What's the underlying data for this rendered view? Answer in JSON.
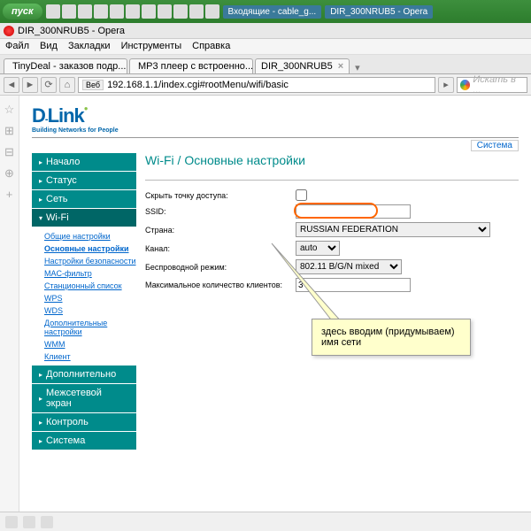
{
  "taskbar": {
    "start": "пуск",
    "items": [
      "Входящие - cable_g...",
      "DIR_300NRUB5 - Opera"
    ]
  },
  "window": {
    "title": "DIR_300NRUB5 - Opera"
  },
  "menu": {
    "file": "Файл",
    "view": "Вид",
    "bookmarks": "Закладки",
    "tools": "Инструменты",
    "help": "Справка"
  },
  "tabs": [
    {
      "label": "TinyDeal - заказов подр..."
    },
    {
      "label": "MP3 плеер с встроенно..."
    },
    {
      "label": "DIR_300NRUB5"
    }
  ],
  "address": {
    "scheme": "Веб",
    "url": "192.168.1.1/index.cgi#rootMenu/wifi/basic",
    "search_placeholder": "Искать в ..."
  },
  "logo": {
    "brand": "D-Link",
    "tagline": "Building Networks for People"
  },
  "toplink": "Система",
  "nav": {
    "start": "Начало",
    "status": "Статус",
    "net": "Сеть",
    "wifi": "Wi-Fi",
    "sub": {
      "general": "Общие настройки",
      "basic": "Основные настройки",
      "security": "Настройки безопасности",
      "mac": "MAC-фильтр",
      "station": "Станционный список",
      "wps": "WPS",
      "wds": "WDS",
      "extra": "Дополнительные настройки",
      "wmm": "WMM",
      "client": "Клиент"
    },
    "advanced": "Дополнительно",
    "firewall": "Межсетевой экран",
    "control": "Контроль",
    "system": "Система"
  },
  "page": {
    "title": "Wi-Fi / Основные настройки",
    "labels": {
      "hide": "Скрыть точку доступа:",
      "ssid": "SSID:",
      "country": "Страна:",
      "channel": "Канал:",
      "mode": "Беспроводной режим:",
      "maxclients": "Максимальное количество клиентов:"
    },
    "values": {
      "ssid": "",
      "country": "RUSSIAN FEDERATION",
      "channel": "auto",
      "mode": "802.11 B/G/N mixed",
      "maxclients": "3"
    }
  },
  "callout": {
    "line1": "здесь вводим (придумываем)",
    "line2": "имя сети"
  }
}
